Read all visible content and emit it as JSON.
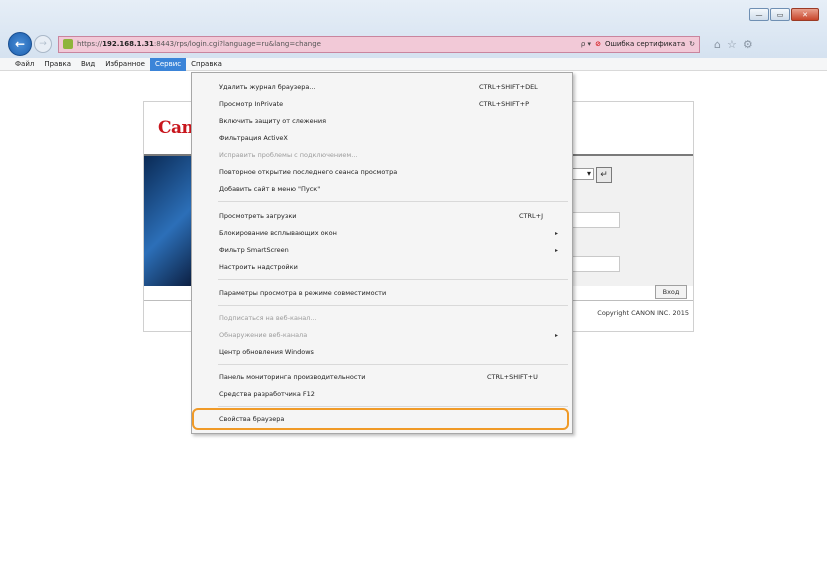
{
  "window": {
    "min_label": "—",
    "max_label": "▭",
    "close_label": "✕"
  },
  "address": {
    "url_prefix": "https://",
    "url_host": "192.168.1.31",
    "url_rest": ":8443/rps/login.cgi?language=ru&lang=change",
    "search_label": "ρ ▾",
    "cert_error": "Ошибка сертификата",
    "refresh": "↻"
  },
  "menubar": [
    {
      "label": "Файл"
    },
    {
      "label": "Правка"
    },
    {
      "label": "Вид"
    },
    {
      "label": "Избранное"
    },
    {
      "label": "Сервис",
      "active": true
    },
    {
      "label": "Справка"
    }
  ],
  "page": {
    "logo": "Canon",
    "select_value": "▾",
    "login_label": "Вход",
    "copyright": "Copyright CANON INC. 2015"
  },
  "menu": {
    "items": [
      {
        "label": "Удалить журнал браузера...",
        "shortcut": "CTRL+SHIFT+DEL"
      },
      {
        "label": "Просмотр InPrivate",
        "shortcut": "CTRL+SHIFT+P"
      },
      {
        "label": "Включить защиту от слежения",
        "shortcut": ""
      },
      {
        "label": "Фильтрация ActiveX",
        "shortcut": ""
      },
      {
        "label": "Исправить проблемы с подключением...",
        "shortcut": ""
      },
      {
        "label": "Повторное открытие последнего сеанса просмотра",
        "shortcut": ""
      },
      {
        "label": "Добавить сайт в меню \"Пуск\"",
        "shortcut": ""
      },
      {
        "label": "Просмотреть загрузки",
        "shortcut": "CTRL+J"
      },
      {
        "label": "Блокирование всплывающих окон",
        "shortcut": ""
      },
      {
        "label": "Фильтр SmartScreen",
        "shortcut": ""
      },
      {
        "label": "Настроить надстройки",
        "shortcut": ""
      },
      {
        "label": "Параметры просмотра в режиме совместимости",
        "shortcut": ""
      },
      {
        "label": "Подписаться на веб-канал...",
        "shortcut": ""
      },
      {
        "label": "Обнаружение веб-канала",
        "shortcut": ""
      },
      {
        "label": "Центр обновления Windows",
        "shortcut": ""
      },
      {
        "label": "Панель мониторинга производительности",
        "shortcut": "CTRL+SHIFT+U"
      },
      {
        "label": "Средства разработчика F12",
        "shortcut": ""
      },
      {
        "label": "Свойства браузера",
        "shortcut": ""
      }
    ],
    "submenu_arrow": "▸"
  }
}
